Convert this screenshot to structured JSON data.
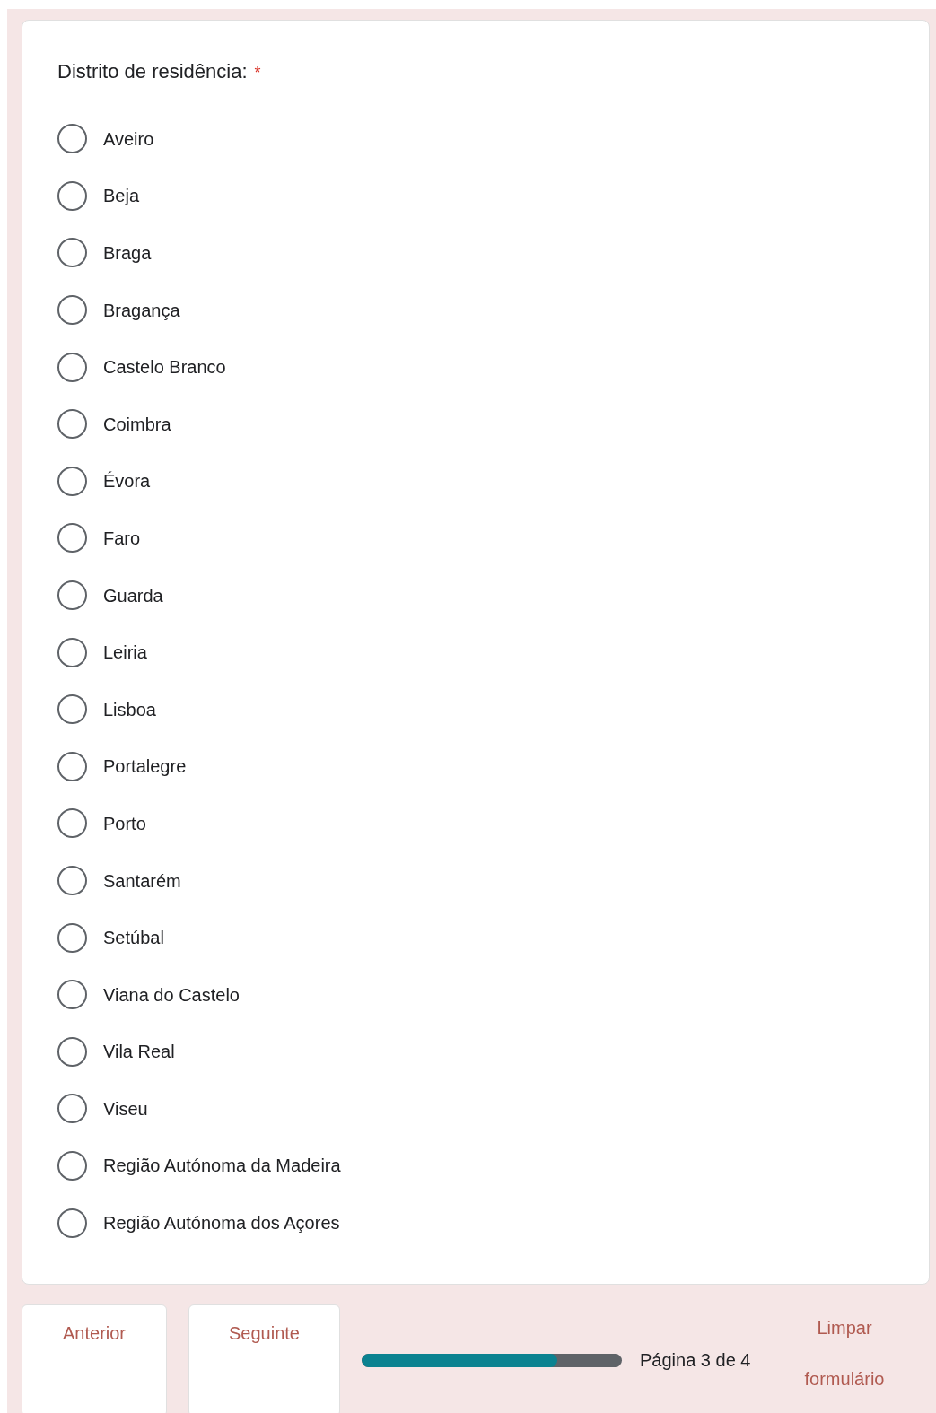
{
  "question": {
    "title": "Distrito de residência:",
    "required_mark": "*",
    "options": [
      {
        "label": "Aveiro",
        "selected": false
      },
      {
        "label": "Beja",
        "selected": false
      },
      {
        "label": "Braga",
        "selected": false
      },
      {
        "label": "Bragança",
        "selected": false
      },
      {
        "label": "Castelo Branco",
        "selected": false
      },
      {
        "label": "Coimbra",
        "selected": false
      },
      {
        "label": "Évora",
        "selected": false
      },
      {
        "label": "Faro",
        "selected": false
      },
      {
        "label": "Guarda",
        "selected": false
      },
      {
        "label": "Leiria",
        "selected": false
      },
      {
        "label": "Lisboa",
        "selected": false
      },
      {
        "label": "Portalegre",
        "selected": false
      },
      {
        "label": "Porto",
        "selected": false
      },
      {
        "label": "Santarém",
        "selected": false
      },
      {
        "label": "Setúbal",
        "selected": false
      },
      {
        "label": "Viana do Castelo",
        "selected": false
      },
      {
        "label": "Vila Real",
        "selected": false
      },
      {
        "label": "Viseu",
        "selected": false
      },
      {
        "label": "Região Autónoma da Madeira",
        "selected": false
      },
      {
        "label": "Região Autónoma dos Açores",
        "selected": false
      }
    ]
  },
  "footer": {
    "buttons": [
      "Anterior",
      "Seguinte"
    ],
    "progress": {
      "level": 0.75,
      "label": "Página 3 de 4"
    },
    "clear_link": "Limpar formulário"
  }
}
